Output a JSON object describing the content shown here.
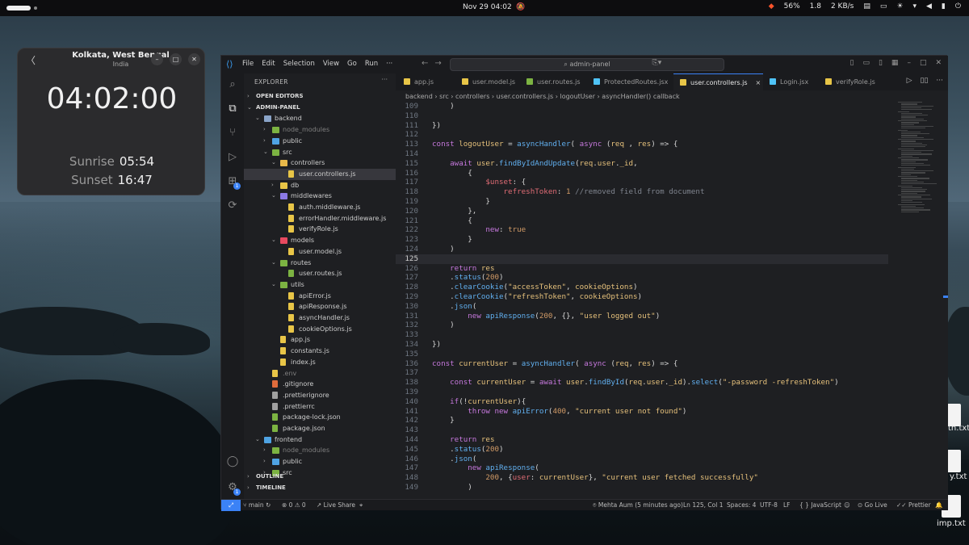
{
  "topbar": {
    "clock": "Nov 29  04:02",
    "battery": "56%",
    "load": "1.8",
    "net": "2 KB/s"
  },
  "clock_app": {
    "city": "Kolkata, West Bengal",
    "country": "India",
    "time": "04:02:00",
    "sunrise_label": "Sunrise",
    "sunrise": "05:54",
    "sunset_label": "Sunset",
    "sunset": "16:47"
  },
  "desktop": {
    "files": [
      "th.txt",
      "y.txt",
      "imp.txt"
    ]
  },
  "vscode": {
    "menu": [
      "File",
      "Edit",
      "Selection",
      "View",
      "Go",
      "Run"
    ],
    "search_placeholder": "admin-panel",
    "explorer_title": "EXPLORER",
    "tree": [
      {
        "label": "OPEN EDITORS",
        "depth": 0,
        "type": "section"
      },
      {
        "label": "ADMIN-PANEL",
        "depth": 0,
        "type": "section-open"
      },
      {
        "label": "backend",
        "depth": 1,
        "type": "folder-open",
        "color": "#8aa4c8"
      },
      {
        "label": "node_modules",
        "depth": 2,
        "type": "folder",
        "color": "#7cb342",
        "dim": true
      },
      {
        "label": "public",
        "depth": 2,
        "type": "folder",
        "color": "#4fa3e3"
      },
      {
        "label": "src",
        "depth": 2,
        "type": "folder-open",
        "color": "#7cb342"
      },
      {
        "label": "controllers",
        "depth": 3,
        "type": "folder-open",
        "color": "#e8b84a"
      },
      {
        "label": "user.controllers.js",
        "depth": 4,
        "type": "file",
        "color": "#e8c547",
        "selected": true
      },
      {
        "label": "db",
        "depth": 3,
        "type": "folder",
        "color": "#e8c547"
      },
      {
        "label": "middlewares",
        "depth": 3,
        "type": "folder-open",
        "color": "#8c7ae6"
      },
      {
        "label": "auth.middleware.js",
        "depth": 4,
        "type": "file",
        "color": "#e8c547"
      },
      {
        "label": "errorHandler.middleware.js",
        "depth": 4,
        "type": "file",
        "color": "#e8c547"
      },
      {
        "label": "verifyRole.js",
        "depth": 4,
        "type": "file",
        "color": "#e8c547"
      },
      {
        "label": "models",
        "depth": 3,
        "type": "folder-open",
        "color": "#e84a5f"
      },
      {
        "label": "user.model.js",
        "depth": 4,
        "type": "file",
        "color": "#e8c547"
      },
      {
        "label": "routes",
        "depth": 3,
        "type": "folder-open",
        "color": "#7cb342"
      },
      {
        "label": "user.routes.js",
        "depth": 4,
        "type": "file",
        "color": "#7cb342"
      },
      {
        "label": "utils",
        "depth": 3,
        "type": "folder-open",
        "color": "#7cb342"
      },
      {
        "label": "apiError.js",
        "depth": 4,
        "type": "file",
        "color": "#e8c547"
      },
      {
        "label": "apiResponse.js",
        "depth": 4,
        "type": "file",
        "color": "#e8c547"
      },
      {
        "label": "asyncHandler.js",
        "depth": 4,
        "type": "file",
        "color": "#e8c547"
      },
      {
        "label": "cookieOptions.js",
        "depth": 4,
        "type": "file",
        "color": "#e8c547"
      },
      {
        "label": "app.js",
        "depth": 3,
        "type": "file",
        "color": "#e8c547"
      },
      {
        "label": "constants.js",
        "depth": 3,
        "type": "file",
        "color": "#e8c547"
      },
      {
        "label": "index.js",
        "depth": 3,
        "type": "file",
        "color": "#e8c547"
      },
      {
        "label": ".env",
        "depth": 2,
        "type": "file",
        "color": "#e8c547",
        "dim": true
      },
      {
        "label": ".gitignore",
        "depth": 2,
        "type": "file",
        "color": "#e06c3c"
      },
      {
        "label": ".prettierignore",
        "depth": 2,
        "type": "file",
        "color": "#a0a0a0"
      },
      {
        "label": ".prettierrc",
        "depth": 2,
        "type": "file",
        "color": "#a0a0a0"
      },
      {
        "label": "package-lock.json",
        "depth": 2,
        "type": "file",
        "color": "#7cb342"
      },
      {
        "label": "package.json",
        "depth": 2,
        "type": "file",
        "color": "#7cb342"
      },
      {
        "label": "frontend",
        "depth": 1,
        "type": "folder-open",
        "color": "#4fa3e3"
      },
      {
        "label": "node_modules",
        "depth": 2,
        "type": "folder",
        "color": "#7cb342",
        "dim": true
      },
      {
        "label": "public",
        "depth": 2,
        "type": "folder",
        "color": "#4fa3e3"
      },
      {
        "label": "src",
        "depth": 2,
        "type": "folder",
        "color": "#7cb342"
      },
      {
        "label": "OUTLINE",
        "depth": 0,
        "type": "section"
      },
      {
        "label": "TIMELINE",
        "depth": 0,
        "type": "section"
      }
    ],
    "tabs": [
      {
        "label": "app.js",
        "color": "#e8c547"
      },
      {
        "label": "user.model.js",
        "color": "#e8c547"
      },
      {
        "label": "user.routes.js",
        "color": "#7cb342"
      },
      {
        "label": "ProtectedRoutes.jsx",
        "color": "#4fc3f7"
      },
      {
        "label": "user.controllers.js",
        "color": "#e8c547",
        "active": true
      },
      {
        "label": "Login.jsx",
        "color": "#4fc3f7"
      },
      {
        "label": "verifyRole.js",
        "color": "#e8c547"
      }
    ],
    "breadcrumbs": "backend  ›  src  ›  controllers  ›  user.controllers.js  ›  logoutUser  ›  asyncHandler() callback",
    "code": [
      {
        "n": "109",
        "t": "    )"
      },
      {
        "n": "110",
        "t": ""
      },
      {
        "n": "111",
        "t": "})"
      },
      {
        "n": "112",
        "t": ""
      },
      {
        "n": "113",
        "t": "const logoutUser = asyncHandler( async (req , res) => {"
      },
      {
        "n": "114",
        "t": ""
      },
      {
        "n": "115",
        "t": "    await user.findByIdAndUpdate(req.user._id,"
      },
      {
        "n": "116",
        "t": "        {"
      },
      {
        "n": "117",
        "t": "            $unset: {"
      },
      {
        "n": "118",
        "t": "                refreshToken: 1 //removed field from document"
      },
      {
        "n": "119",
        "t": "            }"
      },
      {
        "n": "120",
        "t": "        },"
      },
      {
        "n": "121",
        "t": "        {"
      },
      {
        "n": "122",
        "t": "            new: true"
      },
      {
        "n": "123",
        "t": "        }"
      },
      {
        "n": "124",
        "t": "    )"
      },
      {
        "n": "125",
        "t": "",
        "cur": true
      },
      {
        "n": "126",
        "t": "    return res"
      },
      {
        "n": "127",
        "t": "    .status(200)"
      },
      {
        "n": "128",
        "t": "    .clearCookie(\"accessToken\", cookieOptions)"
      },
      {
        "n": "129",
        "t": "    .clearCookie(\"refreshToken\", cookieOptions)"
      },
      {
        "n": "130",
        "t": "    .json("
      },
      {
        "n": "131",
        "t": "        new apiResponse(200, {}, \"user logged out\")"
      },
      {
        "n": "132",
        "t": "    )"
      },
      {
        "n": "133",
        "t": ""
      },
      {
        "n": "134",
        "t": "})"
      },
      {
        "n": "135",
        "t": ""
      },
      {
        "n": "136",
        "t": "const currentUser = asyncHandler( async (req, res) => {"
      },
      {
        "n": "137",
        "t": ""
      },
      {
        "n": "138",
        "t": "    const currentUser = await user.findById(req.user._id).select(\"-password -refreshToken\")"
      },
      {
        "n": "139",
        "t": ""
      },
      {
        "n": "140",
        "t": "    if(!currentUser){"
      },
      {
        "n": "141",
        "t": "        throw new apiError(400, \"current user not found\")"
      },
      {
        "n": "142",
        "t": "    }"
      },
      {
        "n": "143",
        "t": ""
      },
      {
        "n": "144",
        "t": "    return res"
      },
      {
        "n": "145",
        "t": "    .status(200)"
      },
      {
        "n": "146",
        "t": "    .json("
      },
      {
        "n": "147",
        "t": "        new apiResponse("
      },
      {
        "n": "148",
        "t": "            200, {user: currentUser}, \"current user fetched successfully\""
      },
      {
        "n": "149",
        "t": "        )"
      }
    ],
    "status": {
      "branch": "main",
      "problems": "⊗ 0 ⚠ 0",
      "liveshare": "Live Share",
      "blame": "Mehta Aum (5 minutes ago)",
      "position": "Ln 125, Col 1",
      "spaces": "Spaces: 4",
      "encoding": "UTF-8",
      "eol": "LF",
      "language": "JavaScript",
      "golive": "Go Live",
      "prettier": "Prettier"
    },
    "colors": {
      "accent": "#3b82f6",
      "keyword": "#c678dd",
      "func": "#61afef",
      "string": "#e5c07b",
      "var": "#e06c75",
      "number": "#d19a66",
      "comment": "#7f848e"
    }
  }
}
